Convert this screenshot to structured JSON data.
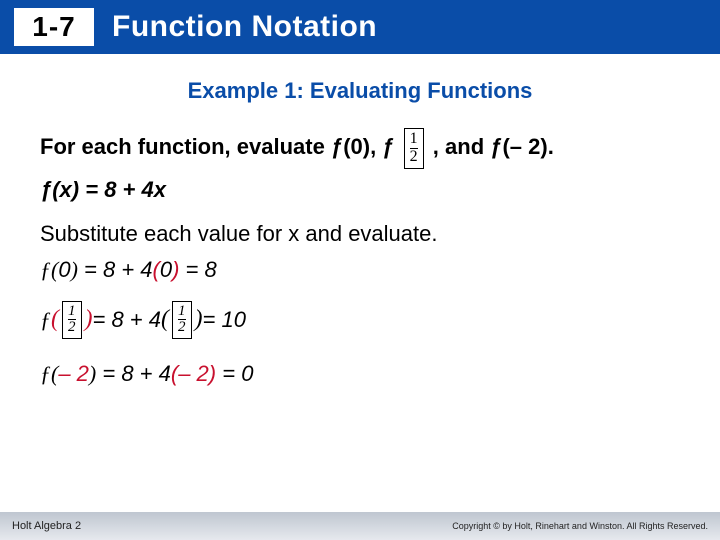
{
  "header": {
    "section_number": "1-7",
    "title": "Function Notation"
  },
  "example_title": "Example 1: Evaluating Functions",
  "problem": {
    "prefix": "For each function, evaluate ƒ(0), ƒ",
    "fraction": {
      "num": "1",
      "den": "2"
    },
    "suffix": ",  and ƒ(– 2)."
  },
  "definition": "ƒ(x) = 8 + 4x",
  "explanation": "Substitute each value for x and evaluate.",
  "work": {
    "line1": {
      "fx_open": "ƒ(",
      "arg": "0",
      "fx_close": ")",
      "rhs_a": " = 8 + 4",
      "sub_open": "(",
      "sub_val": "0",
      "sub_close": ")",
      "result": " = 8"
    },
    "line2": {
      "fx": "ƒ",
      "arg_frac": {
        "num": "1",
        "den": "2"
      },
      "rhs_a": " = 8 + 4",
      "sub_frac": {
        "num": "1",
        "den": "2"
      },
      "result": " = 10"
    },
    "line3": {
      "fx_open": "ƒ(",
      "arg": "– 2",
      "fx_close": ")",
      "rhs_a": " = 8 + 4",
      "sub_open": "(",
      "sub_val": "– 2",
      "sub_close": ")",
      "result": " = 0"
    }
  },
  "footer": {
    "left": "Holt Algebra 2",
    "right": "Copyright © by Holt, Rinehart and Winston. All Rights Reserved."
  }
}
